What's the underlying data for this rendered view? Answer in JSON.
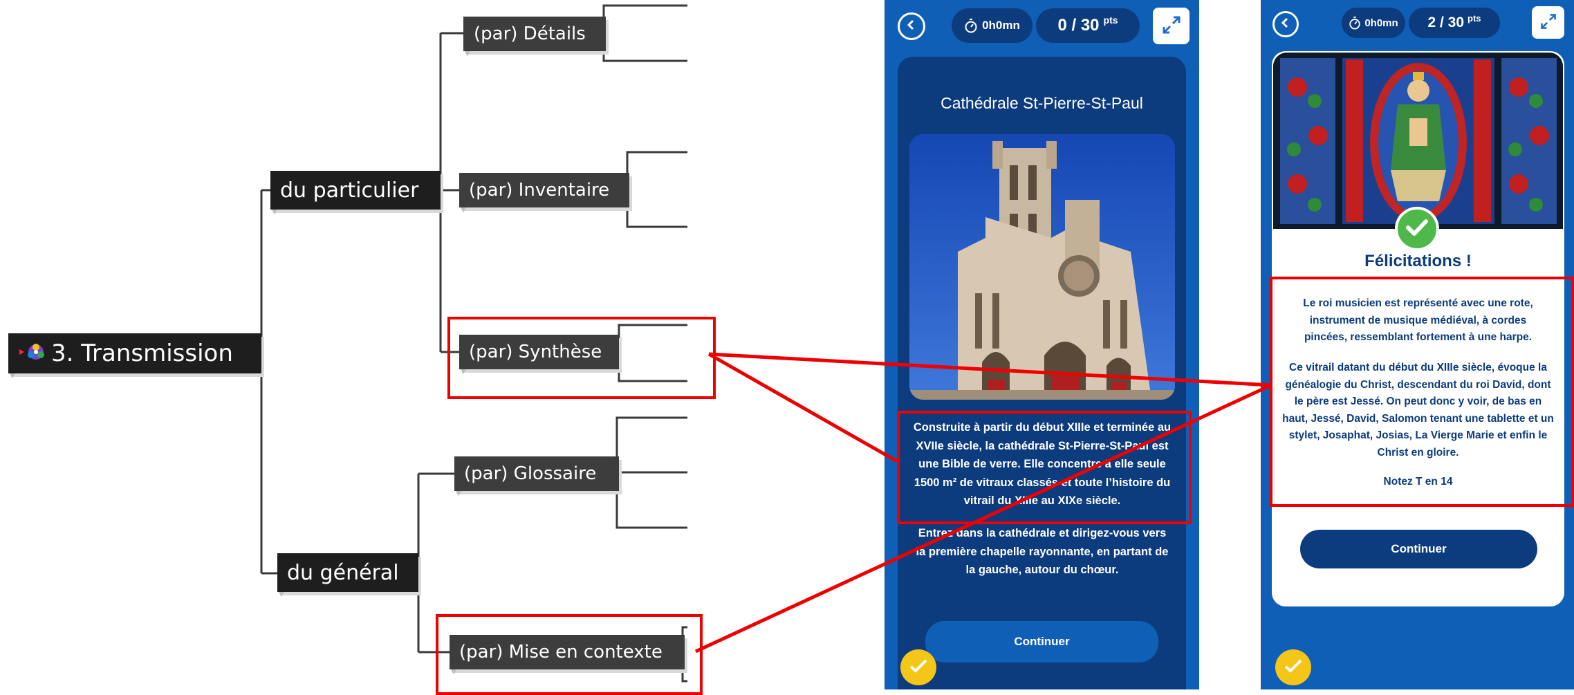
{
  "mindmap": {
    "root": "3. Transmission",
    "branches": {
      "particulier": "du particulier",
      "general": "du général"
    },
    "leaves": {
      "details": "(par) Détails",
      "inventaire": "(par) Inventaire",
      "synthese": "(par) Synthèse",
      "glossaire": "(par) Glossaire",
      "contexte": "(par) Mise en contexte"
    }
  },
  "phone1": {
    "timer": "0h0mn",
    "score": "0 / 30",
    "score_unit": "pts",
    "title": "Cathédrale St-Pierre-St-Paul",
    "paragraph1": "Construite à partir du début XIIIe et terminée au XVIIe siècle, la cathédrale St-Pierre-St-Paul est une Bible de verre. Elle concentre à elle seule 1500 m² de vitraux classés et toute l’histoire du vitrail du XIIIe au XIXe siècle.",
    "paragraph2": "Entrez dans la cathédrale et dirigez-vous vers la première chapelle rayonnante, en partant de la gauche, autour du chœur.",
    "continue": "Continuer"
  },
  "phone2": {
    "timer": "0h0mn",
    "score": "2 / 30",
    "score_unit": "pts",
    "heading": "Félicitations !",
    "paragraph1": "Le roi musicien est représenté avec une rote, instrument de musique médiéval, à cordes pincées, ressemblant fortement à une harpe.",
    "paragraph2": "Ce vitrail datant du début du XIIIe siècle, évoque la généalogie du Christ, descendant du roi David, dont le père est Jessé. On peut donc y voir, de bas en haut, Jessé, David, Salomon tenant une tablette et un stylet, Josaphat, Josias, La Vierge Marie et enfin le Christ en gloire.",
    "note": "Notez T en 14",
    "continue": "Continuer"
  },
  "colors": {
    "phone_blue": "#0f5fb6",
    "card_navy": "#0c3c7d",
    "highlight_red": "#ee0000",
    "node_dark": "#3d3d3d",
    "badge_yellow": "#f5c518",
    "check_green": "#4fb84a"
  },
  "icons": [
    "back-arrow-icon",
    "stopwatch-icon",
    "expand-icon",
    "check-icon",
    "hand-check-icon",
    "mindmap-logo-icon"
  ]
}
